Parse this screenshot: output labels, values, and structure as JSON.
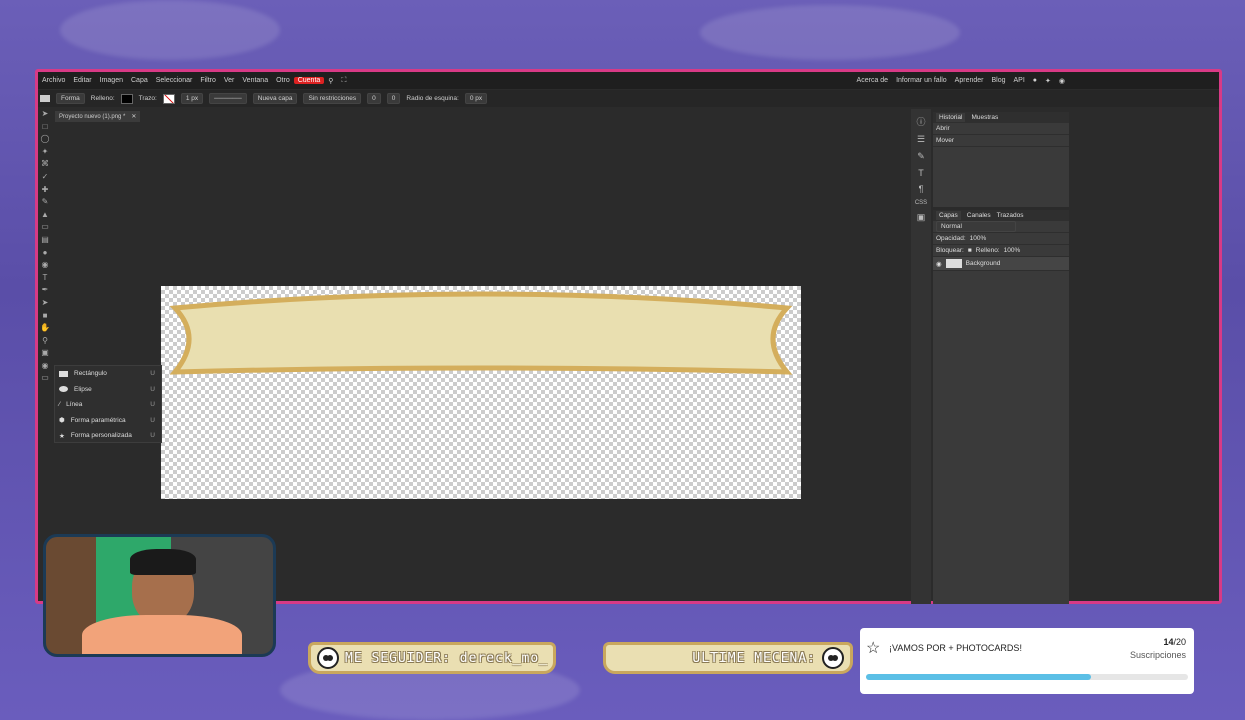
{
  "menubar": {
    "items": [
      "Archivo",
      "Editar",
      "Imagen",
      "Capa",
      "Seleccionar",
      "Filtro",
      "Ver",
      "Ventana",
      "Otro",
      "Cuenta"
    ],
    "right_items": [
      "Acerca de",
      "Informar un fallo",
      "Aprender",
      "Blog",
      "API"
    ]
  },
  "optionsbar": {
    "shape_select": "Forma",
    "fill_label": "Relleno:",
    "stroke_label": "Trazo:",
    "stroke_width": "1 px",
    "layer_select": "Nueva capa",
    "constraint_select": "Sin restricciones",
    "w_value": "0",
    "h_value": "0",
    "radius_label": "Radio de esquina:",
    "radius_value": "0 px"
  },
  "document": {
    "tab_title": "Proyecto nuevo (1).png *"
  },
  "shape_flyout": {
    "items": [
      {
        "label": "Rectángulo",
        "key": "U"
      },
      {
        "label": "Elipse",
        "key": "U"
      },
      {
        "label": "Línea",
        "key": "U"
      },
      {
        "label": "Forma paramétrica",
        "key": "U"
      },
      {
        "label": "Forma personalizada",
        "key": "U"
      }
    ]
  },
  "history_panel": {
    "tabs": [
      "Historial",
      "Muestras"
    ],
    "entries": [
      "Abrir",
      "Mover"
    ]
  },
  "layers_panel": {
    "tabs": [
      "Capas",
      "Canales",
      "Trazados"
    ],
    "blend_mode": "Normal",
    "opacity_label": "Opacidad:",
    "opacity_value": "100%",
    "lock_label": "Bloquear:",
    "fill_label": "Relleno:",
    "fill_value": "100%",
    "layers": [
      "Background"
    ]
  },
  "overlay": {
    "follower_banner": "ME SEGUIDER: dereck_mo_",
    "patron_banner": "ULTIME MECENA:",
    "goal_title": "¡VAMOS POR + PHOTOCARDS!",
    "goal_current": "14",
    "goal_total": "/20",
    "goal_subtitle": "Suscripciones",
    "goal_progress": 0.7
  },
  "colors": {
    "frame_border": "#d83a86",
    "accent_red": "#dd2222",
    "banner_fill": "#eadfb2",
    "banner_stroke": "#c9a75d",
    "goal_bar": "#5bbfe6"
  }
}
